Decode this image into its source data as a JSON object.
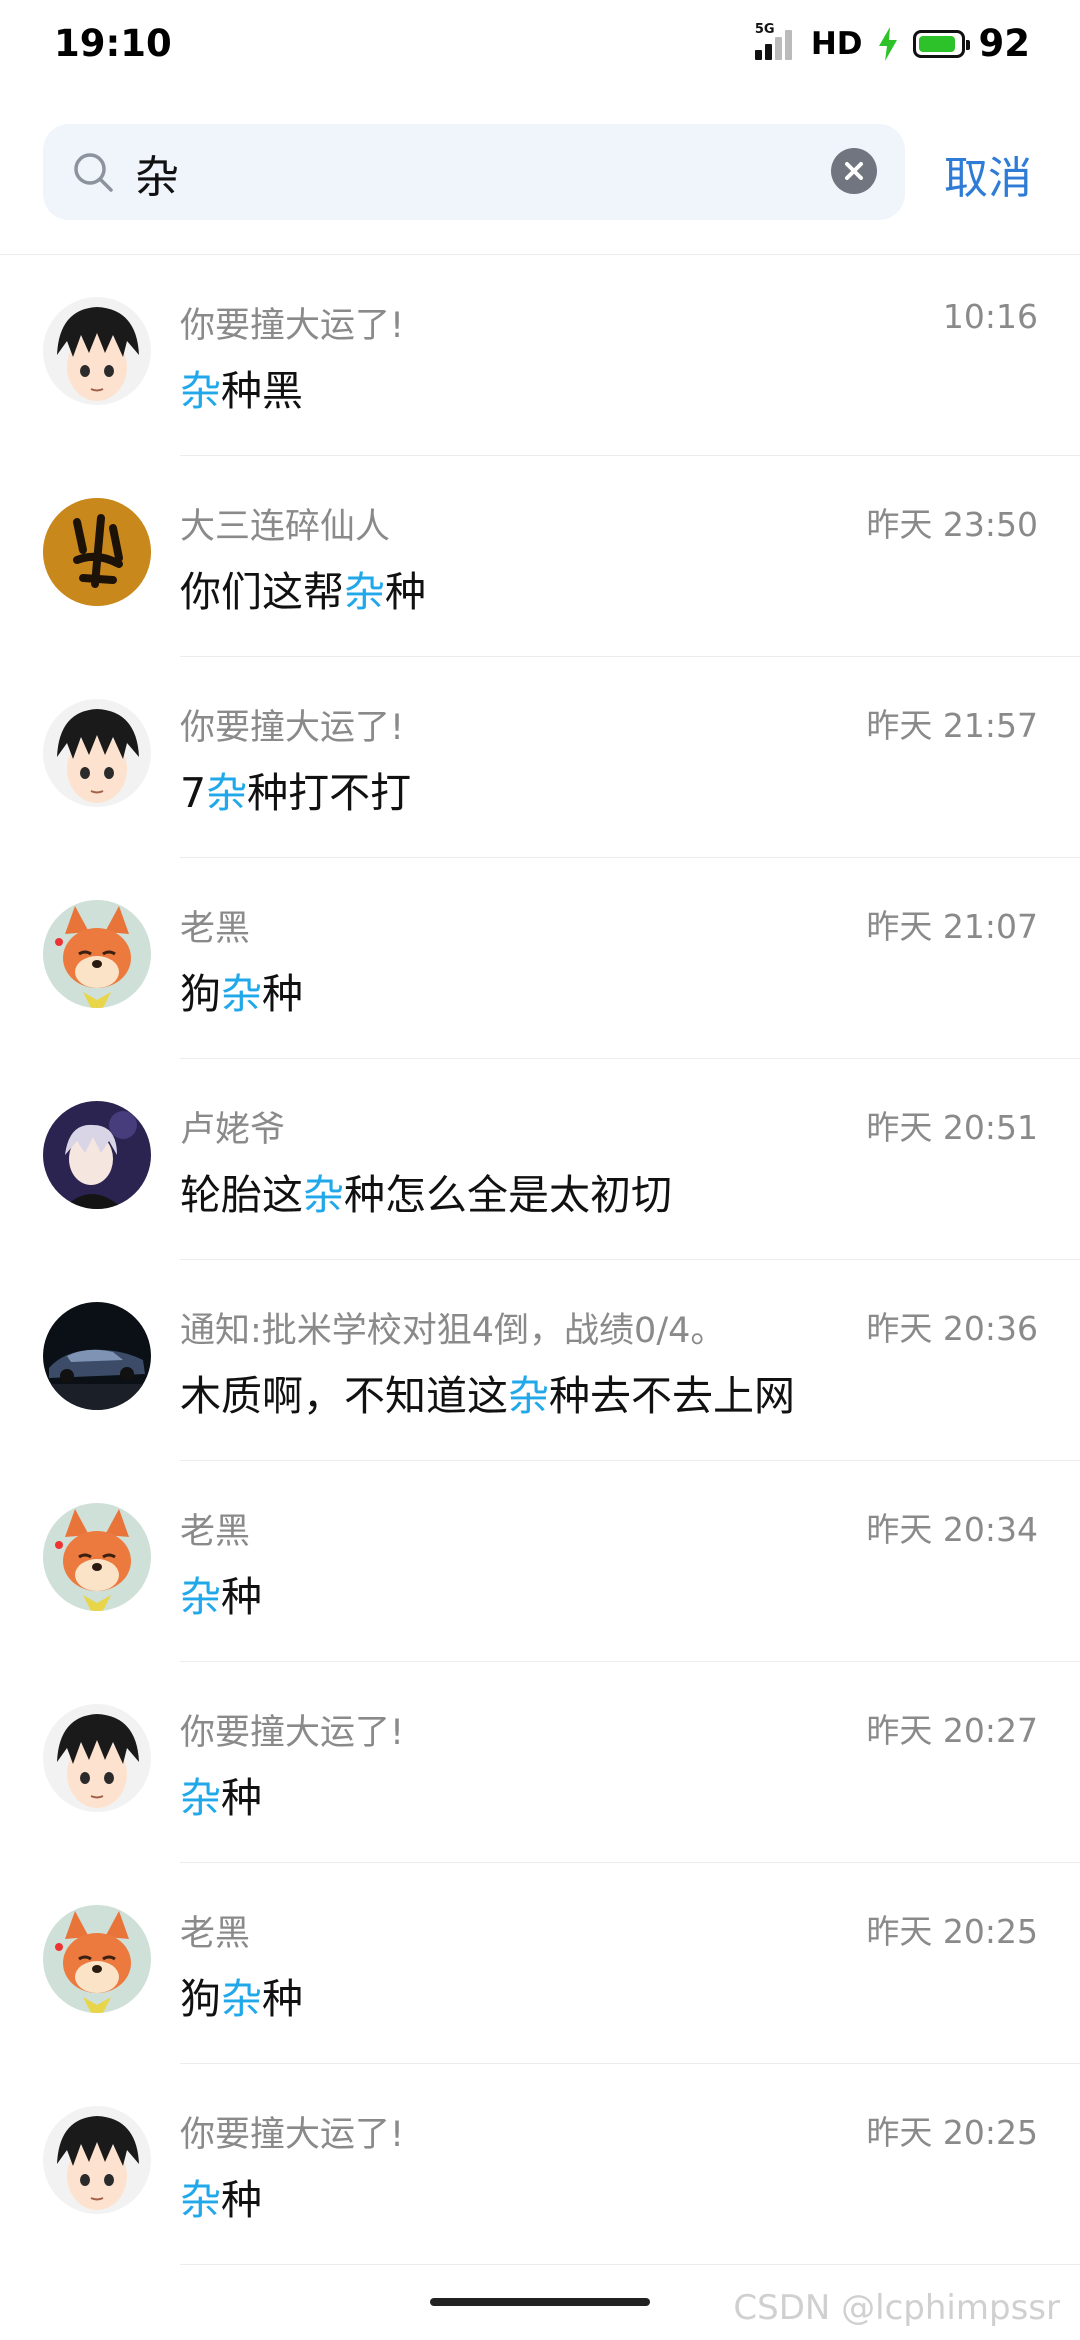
{
  "status_bar": {
    "time": "19:10",
    "network": "5G",
    "hd_label": "HD",
    "battery_percent": "92",
    "battery_level": 0.92
  },
  "search": {
    "query": "杂",
    "cancel_label": "取消"
  },
  "colors": {
    "highlight": "#21a8ea",
    "cancel": "#2e7cd6"
  },
  "results": [
    {
      "name": "你要撞大运了!",
      "time": "10:16",
      "avatar": "black-hair-boy",
      "msg_pre": "",
      "msg_hl": "杂",
      "msg_post": "种黑"
    },
    {
      "name": "大三连碎仙人",
      "time": "昨天 23:50",
      "avatar": "calligraphy",
      "msg_pre": "你们这帮",
      "msg_hl": "杂",
      "msg_post": "种"
    },
    {
      "name": "你要撞大运了!",
      "time": "昨天 21:57",
      "avatar": "black-hair-boy",
      "msg_pre": "7",
      "msg_hl": "杂",
      "msg_post": "种打不打"
    },
    {
      "name": "老黑",
      "time": "昨天 21:07",
      "avatar": "fox",
      "msg_pre": "狗",
      "msg_hl": "杂",
      "msg_post": "种"
    },
    {
      "name": "卢姥爷",
      "time": "昨天 20:51",
      "avatar": "anime-silver-hair",
      "msg_pre": "轮胎这",
      "msg_hl": "杂",
      "msg_post": "种怎么全是太初切"
    },
    {
      "name": "通知:批米学校对狙4倒，战绩0/4。",
      "time": "昨天 20:36",
      "avatar": "car",
      "msg_pre": "木质啊，不知道这",
      "msg_hl": "杂",
      "msg_post": "种去不去上网"
    },
    {
      "name": "老黑",
      "time": "昨天 20:34",
      "avatar": "fox",
      "msg_pre": "",
      "msg_hl": "杂",
      "msg_post": "种"
    },
    {
      "name": "你要撞大运了!",
      "time": "昨天 20:27",
      "avatar": "black-hair-boy",
      "msg_pre": "",
      "msg_hl": "杂",
      "msg_post": "种"
    },
    {
      "name": "老黑",
      "time": "昨天 20:25",
      "avatar": "fox",
      "msg_pre": "狗",
      "msg_hl": "杂",
      "msg_post": "种"
    },
    {
      "name": "你要撞大运了!",
      "time": "昨天 20:25",
      "avatar": "black-hair-boy",
      "msg_pre": "",
      "msg_hl": "杂",
      "msg_post": "种"
    }
  ],
  "watermark": "CSDN @lcphimpssr"
}
